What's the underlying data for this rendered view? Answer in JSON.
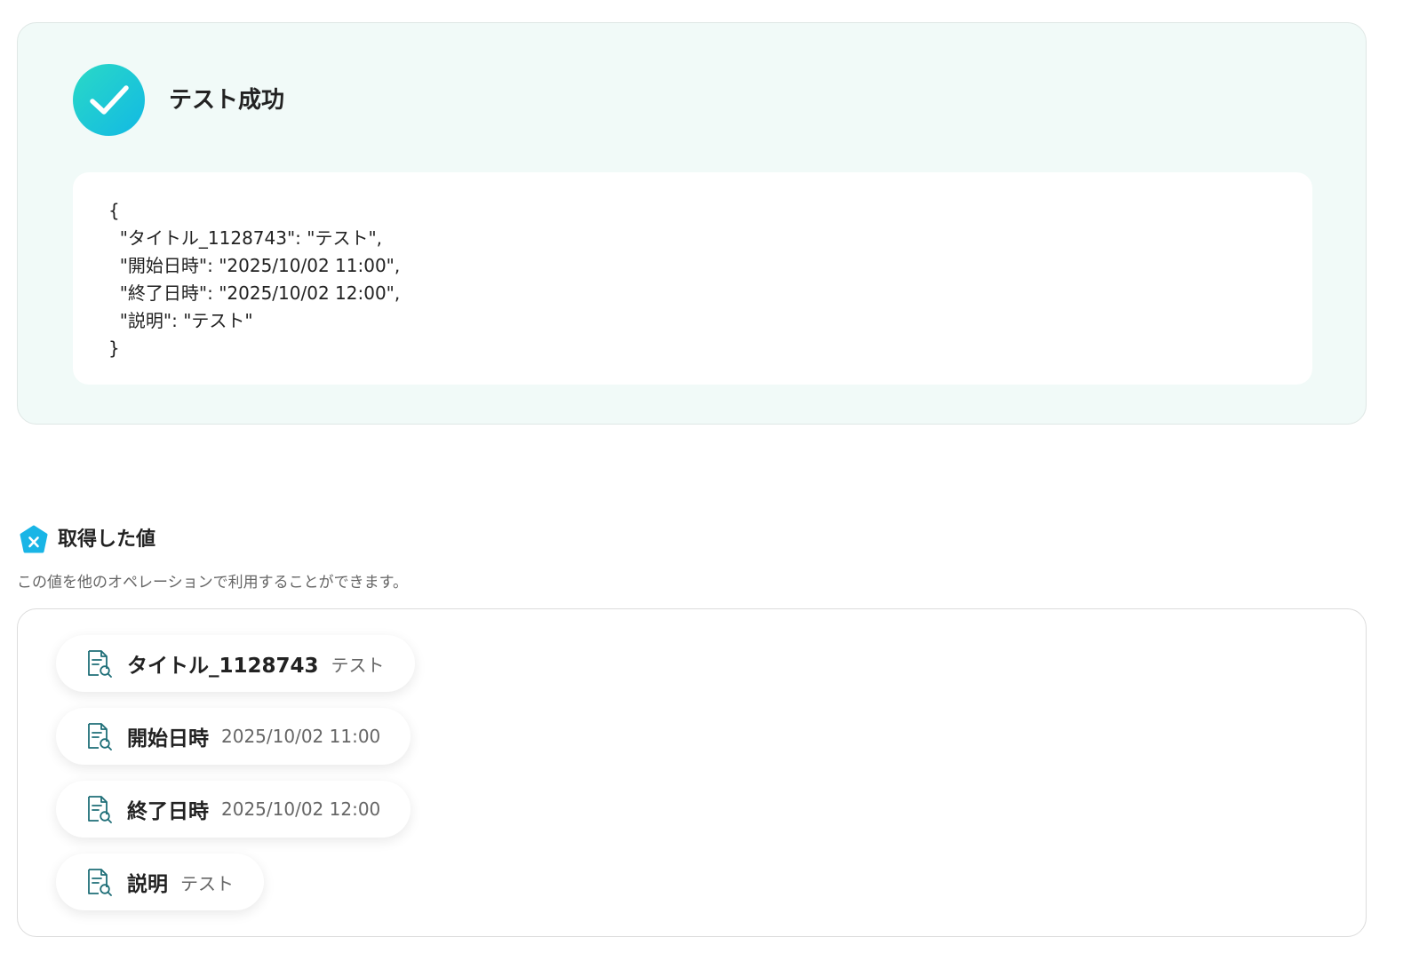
{
  "test_result": {
    "status_title": "テスト成功",
    "json_lines": [
      "{",
      "  \"タイトル_1128743\": \"テスト\",",
      "  \"開始日時\": \"2025/10/02 11:00\",",
      "  \"終了日時\": \"2025/10/02 12:00\",",
      "  \"説明\": \"テスト\"",
      "}"
    ]
  },
  "acquired_values": {
    "title": "取得した値",
    "badge_icon": "x-pentagon-icon",
    "description": "この値を他のオペレーションで利用することができます。",
    "items": [
      {
        "key": "タイトル_1128743",
        "value": "テスト",
        "icon": "document-search-icon"
      },
      {
        "key": "開始日時",
        "value": "2025/10/02 11:00",
        "icon": "document-search-icon"
      },
      {
        "key": "終了日時",
        "value": "2025/10/02 12:00",
        "icon": "document-search-icon"
      },
      {
        "key": "説明",
        "value": "テスト",
        "icon": "document-search-icon"
      }
    ]
  },
  "colors": {
    "success_gradient_start": "#2ad9c6",
    "success_gradient_end": "#12b9e4",
    "panel_background": "#f1faf8",
    "icon_teal": "#1f6f78",
    "badge_blue": "#19b5e6"
  }
}
